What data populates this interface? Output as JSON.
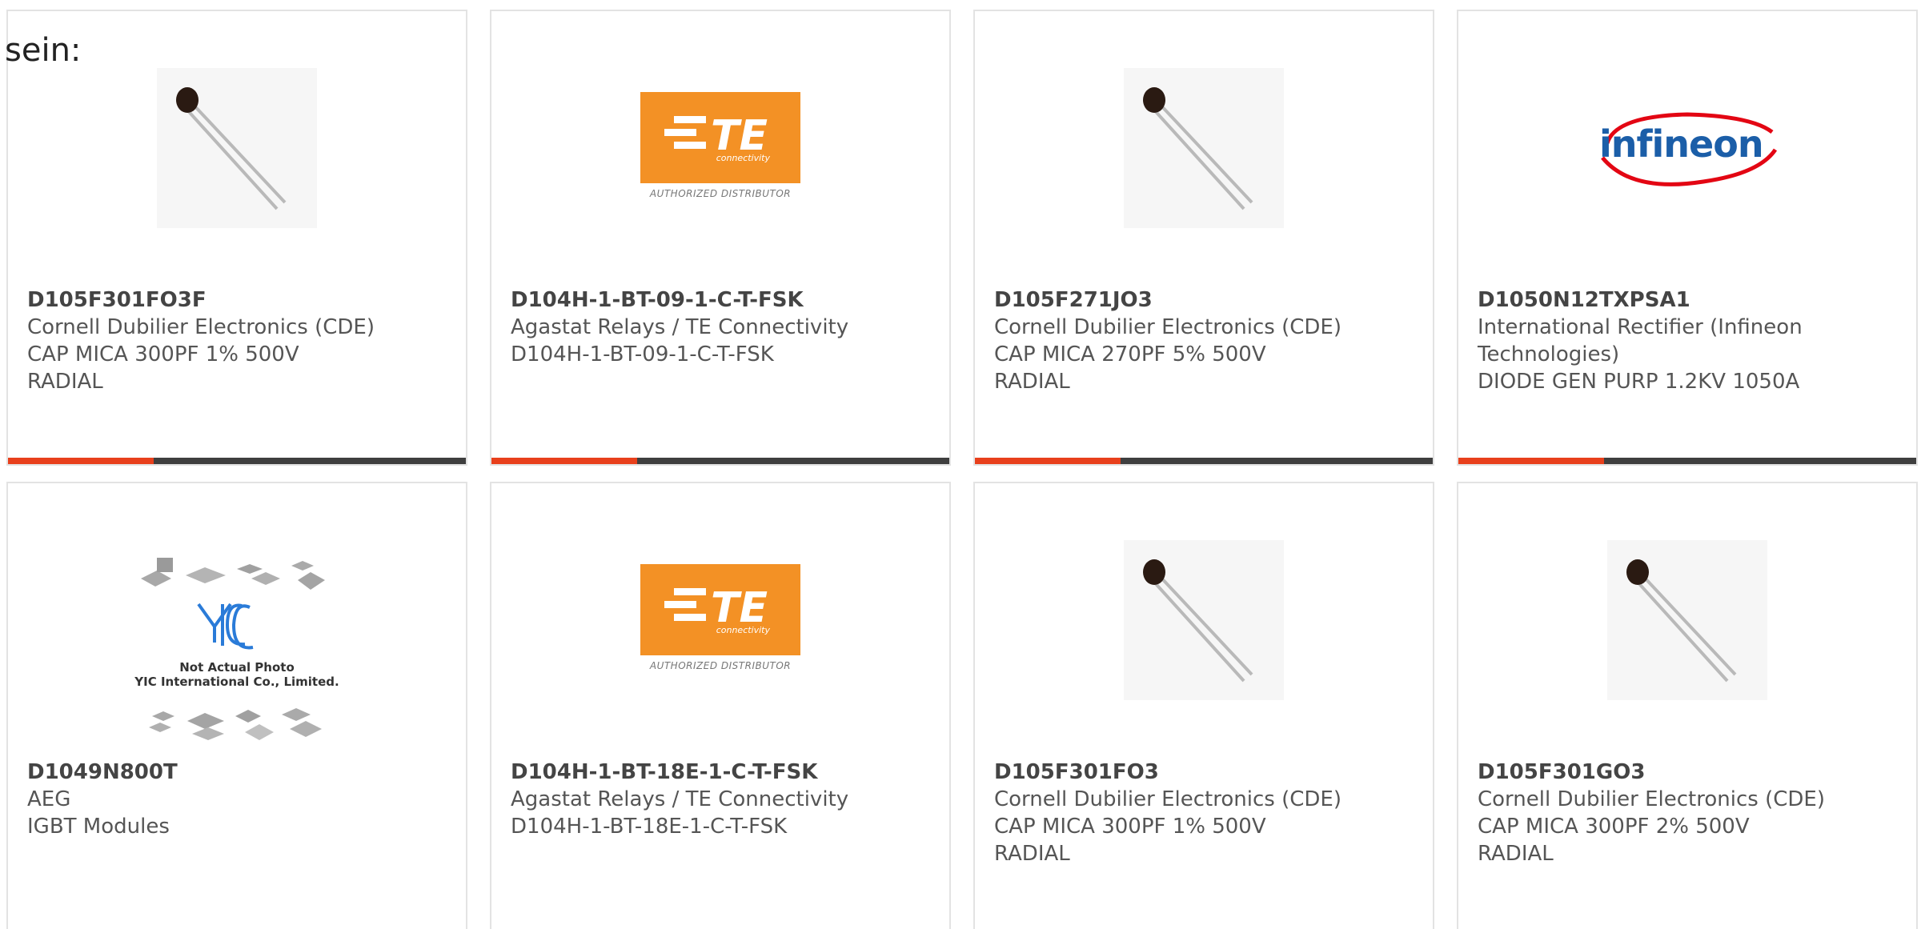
{
  "intro_text": "sein:",
  "colors": {
    "accent_red": "#e8401c",
    "bar_dark": "#3f3f3f",
    "te_orange": "#f39125",
    "infineon_blue": "#1b5ea8",
    "infineon_red": "#e30613",
    "yic_blue": "#2a7bd8"
  },
  "cards": [
    {
      "part_number": "D105F301FO3F",
      "manufacturer": "Cornell Dubilier Electronics (CDE)",
      "description_lines": [
        "CAP MICA 300PF 1% 500V",
        "RADIAL"
      ],
      "image_type": "capacitor-photo"
    },
    {
      "part_number": "D104H-1-BT-09-1-C-T-FSK",
      "manufacturer": "Agastat Relays / TE Connectivity",
      "description_lines": [
        "D104H-1-BT-09-1-C-T-FSK"
      ],
      "image_type": "te-logo",
      "logo_text": "TE",
      "logo_subtext": "connectivity",
      "logo_caption": "AUTHORIZED DISTRIBUTOR"
    },
    {
      "part_number": "D105F271JO3",
      "manufacturer": "Cornell Dubilier Electronics (CDE)",
      "description_lines": [
        "CAP MICA 270PF 5% 500V",
        "RADIAL"
      ],
      "image_type": "capacitor-photo"
    },
    {
      "part_number": "D1050N12TXPSA1",
      "manufacturer_lines": [
        "International Rectifier (Infineon",
        "Technologies)"
      ],
      "description_lines": [
        "DIODE GEN PURP 1.2KV 1050A"
      ],
      "image_type": "infineon-logo",
      "logo_text": "infineon"
    },
    {
      "part_number": "D1049N800T",
      "manufacturer": "AEG",
      "description_lines": [
        "IGBT Modules"
      ],
      "image_type": "yic-placeholder",
      "logo_text": "YIC",
      "placeholder_line1": "Not Actual Photo",
      "placeholder_line2": "YIC International Co., Limited."
    },
    {
      "part_number": "D104H-1-BT-18E-1-C-T-FSK",
      "manufacturer": "Agastat Relays / TE Connectivity",
      "description_lines": [
        "D104H-1-BT-18E-1-C-T-FSK"
      ],
      "image_type": "te-logo",
      "logo_text": "TE",
      "logo_subtext": "connectivity",
      "logo_caption": "AUTHORIZED DISTRIBUTOR"
    },
    {
      "part_number": "D105F301FO3",
      "manufacturer": "Cornell Dubilier Electronics (CDE)",
      "description_lines": [
        "CAP MICA 300PF 1% 500V",
        "RADIAL"
      ],
      "image_type": "capacitor-photo"
    },
    {
      "part_number": "D105F301GO3",
      "manufacturer": "Cornell Dubilier Electronics (CDE)",
      "description_lines": [
        "CAP MICA 300PF 2% 500V",
        "RADIAL"
      ],
      "image_type": "capacitor-photo"
    }
  ]
}
